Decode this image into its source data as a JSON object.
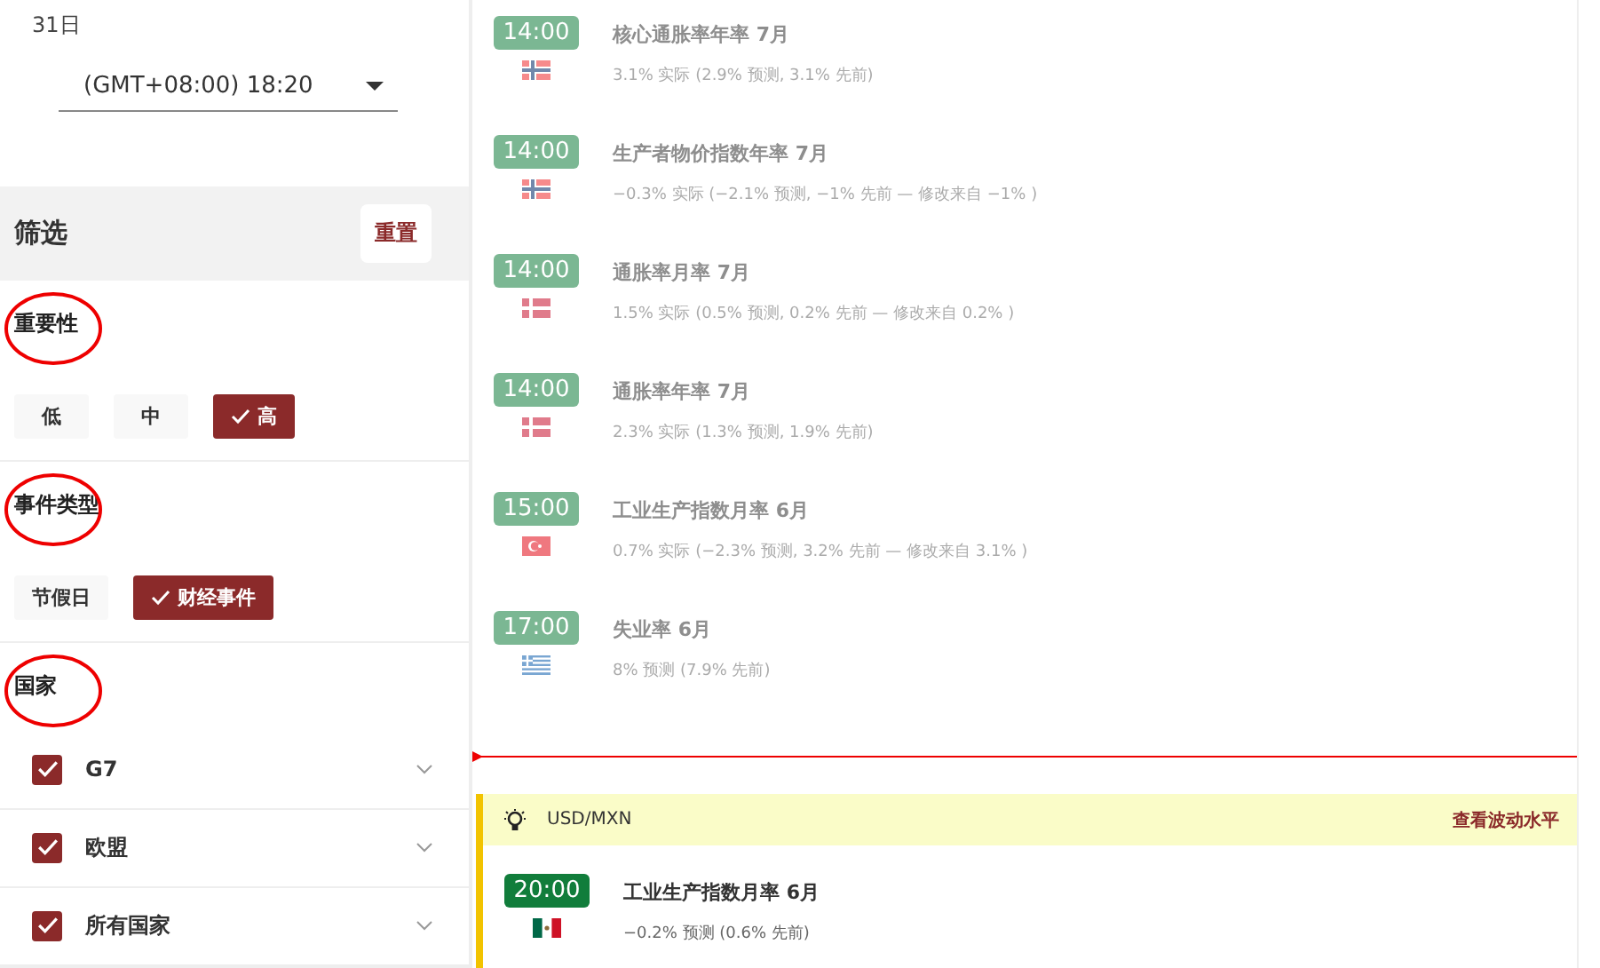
{
  "sidebar": {
    "date": "31日",
    "timezone": "(GMT+08:00) 18:20",
    "filter": {
      "title": "筛选",
      "reset": "重置"
    },
    "sections": [
      {
        "title": "重要性",
        "kind": "chips",
        "annotated": true,
        "chips": [
          {
            "label": "低",
            "selected": false
          },
          {
            "label": "中",
            "selected": false
          },
          {
            "label": "高",
            "selected": true
          }
        ]
      },
      {
        "title": "事件类型",
        "kind": "chips",
        "annotated": true,
        "chips": [
          {
            "label": "节假日",
            "selected": false
          },
          {
            "label": "财经事件",
            "selected": true
          }
        ]
      },
      {
        "title": "国家",
        "kind": "countries",
        "annotated": true,
        "items": [
          {
            "label": "G7",
            "checked": true
          },
          {
            "label": "欧盟",
            "checked": true
          },
          {
            "label": "所有国家",
            "checked": true
          }
        ]
      }
    ]
  },
  "events": [
    {
      "time": "14:00",
      "kind": "norway",
      "title": "核心通胀率年率 7月",
      "detail": "3.1% 实际 (2.9% 预测, 3.1% 先前)",
      "past": true
    },
    {
      "time": "14:00",
      "kind": "norway",
      "title": "生产者物价指数年率 7月",
      "detail": "−0.3% 实际 (−2.1% 预测, −1% 先前 — 修改来自 −1% )",
      "past": true
    },
    {
      "time": "14:00",
      "kind": "denmark",
      "title": "通胀率月率 7月",
      "detail": "1.5% 实际 (0.5% 预测, 0.2% 先前 — 修改来自 0.2% )",
      "past": true
    },
    {
      "time": "14:00",
      "kind": "denmark",
      "title": "通胀率年率 7月",
      "detail": "2.3% 实际 (1.3% 预测, 1.9% 先前)",
      "past": true
    },
    {
      "time": "15:00",
      "kind": "turkey",
      "title": "工业生产指数月率 6月",
      "detail": "0.7% 实际 (−2.3% 预测, 3.2% 先前 — 修改来自 3.1% )",
      "past": true
    },
    {
      "time": "17:00",
      "kind": "greece",
      "title": "失业率 6月",
      "detail": "8% 预测 (7.9% 先前)",
      "past": true
    }
  ],
  "highlight": {
    "pair": "USD/MXN",
    "link": "查看波动水平",
    "event": {
      "time": "20:00",
      "kind": "mexico",
      "title": "工业生产指数月率 6月",
      "detail": "−0.2% 预测 (0.6% 先前)",
      "past": false
    }
  }
}
